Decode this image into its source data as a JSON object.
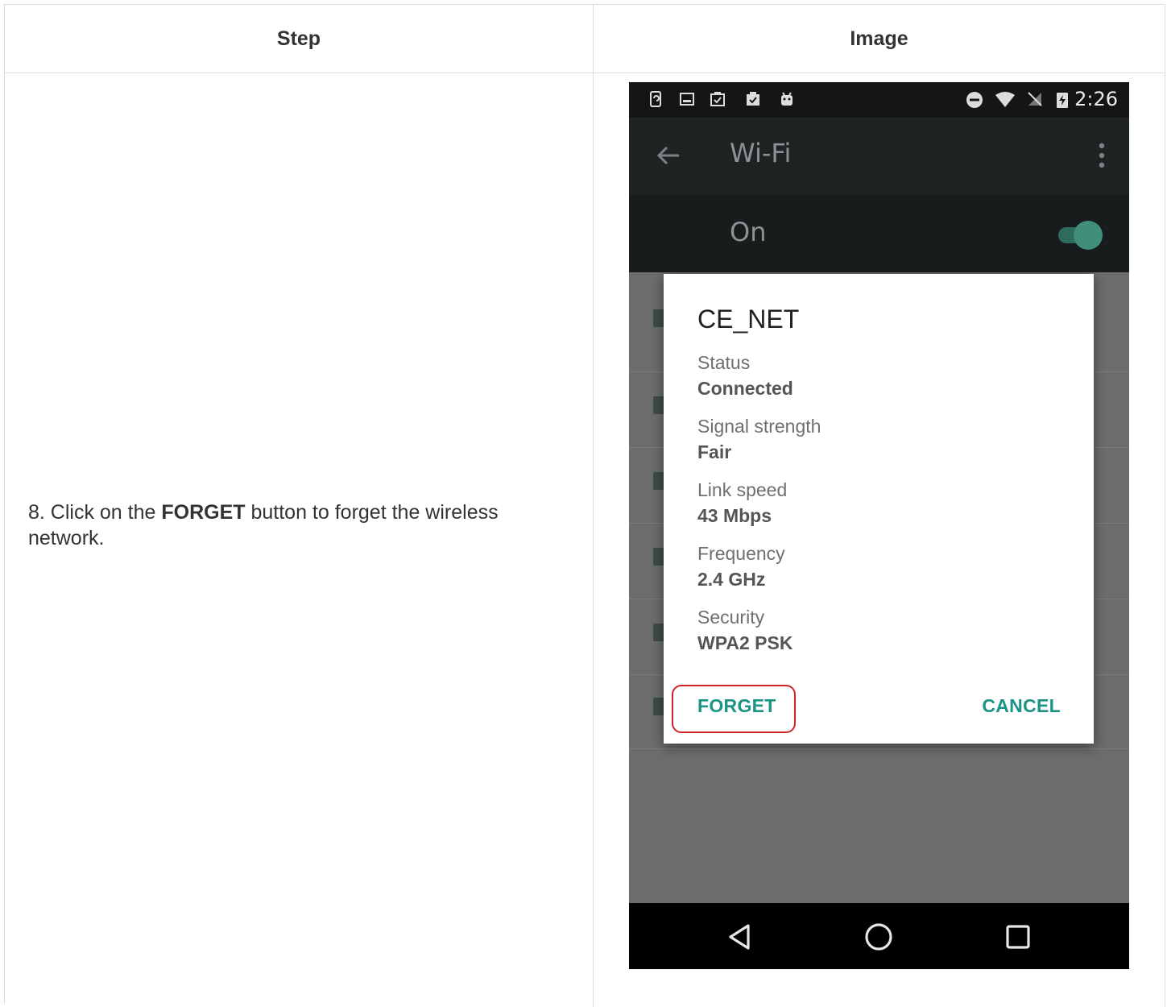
{
  "table": {
    "header_step": "Step",
    "header_image": "Image"
  },
  "step": {
    "prefix": "8. Click on the ",
    "bold": "FORGET",
    "suffix": " button to forget the wireless network."
  },
  "phone": {
    "status_time": "2:26",
    "appbar_title": "Wi-Fi",
    "switch_label": "On",
    "toggle_on": true,
    "accent_color": "#199486",
    "dialog": {
      "title": "CE_NET",
      "fields": [
        {
          "label": "Status",
          "value": "Connected"
        },
        {
          "label": "Signal strength",
          "value": "Fair"
        },
        {
          "label": "Link speed",
          "value": "43 Mbps"
        },
        {
          "label": "Frequency",
          "value": "2.4 GHz"
        },
        {
          "label": "Security",
          "value": "WPA2 PSK"
        }
      ],
      "forget_label": "FORGET",
      "cancel_label": "CANCEL"
    },
    "highlight_color": "#d0242b"
  }
}
